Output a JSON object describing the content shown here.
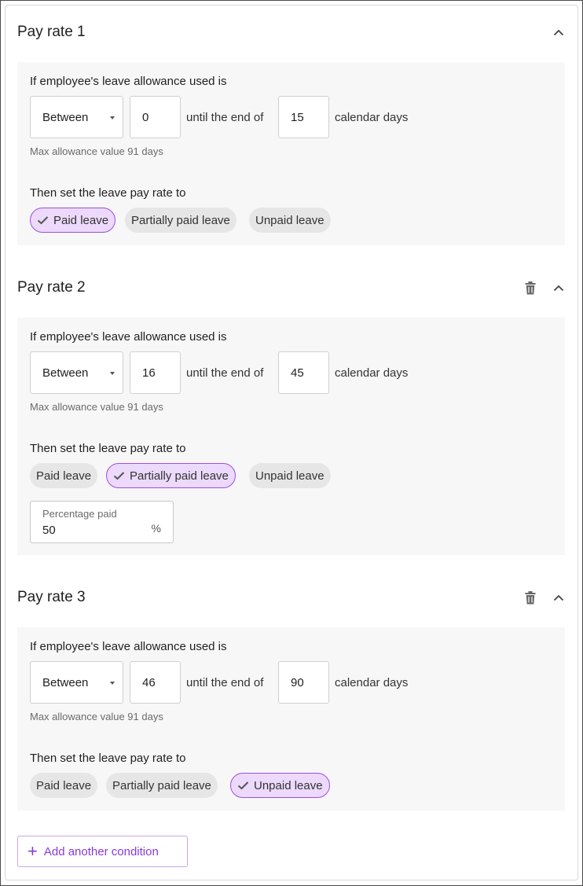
{
  "accent_color": "#9b50e0",
  "rates": [
    {
      "title": "Pay rate 1",
      "deletable": false,
      "condition_label": "If employee's leave allowance used is",
      "operator": "Between",
      "from": "0",
      "until_text": "until the end of",
      "to": "15",
      "unit_text": "calendar days",
      "hint": "Max allowance value 91 days",
      "then_label": "Then set the leave pay rate to",
      "options": [
        "Paid leave",
        "Partially paid leave",
        "Unpaid leave"
      ],
      "selected": "Paid leave"
    },
    {
      "title": "Pay rate 2",
      "deletable": true,
      "condition_label": "If employee's leave allowance used is",
      "operator": "Between",
      "from": "16",
      "until_text": "until the end of",
      "to": "45",
      "unit_text": "calendar days",
      "hint": "Max allowance value 91 days",
      "then_label": "Then set the leave pay rate to",
      "options": [
        "Paid leave",
        "Partially paid leave",
        "Unpaid leave"
      ],
      "selected": "Partially paid leave",
      "percentage": {
        "label": "Percentage paid",
        "value": "50",
        "unit": "%"
      }
    },
    {
      "title": "Pay rate 3",
      "deletable": true,
      "condition_label": "If employee's leave allowance used is",
      "operator": "Between",
      "from": "46",
      "until_text": "until the end of",
      "to": "90",
      "unit_text": "calendar days",
      "hint": "Max allowance value 91 days",
      "then_label": "Then set the leave pay rate to",
      "options": [
        "Paid leave",
        "Partially paid leave",
        "Unpaid leave"
      ],
      "selected": "Unpaid leave"
    }
  ],
  "add_condition_label": "Add another condition",
  "icons": {
    "delete": "trash-icon",
    "collapse": "chevron-up-icon",
    "check": "check-icon",
    "add": "plus-icon",
    "dropdown": "caret-down-icon"
  }
}
